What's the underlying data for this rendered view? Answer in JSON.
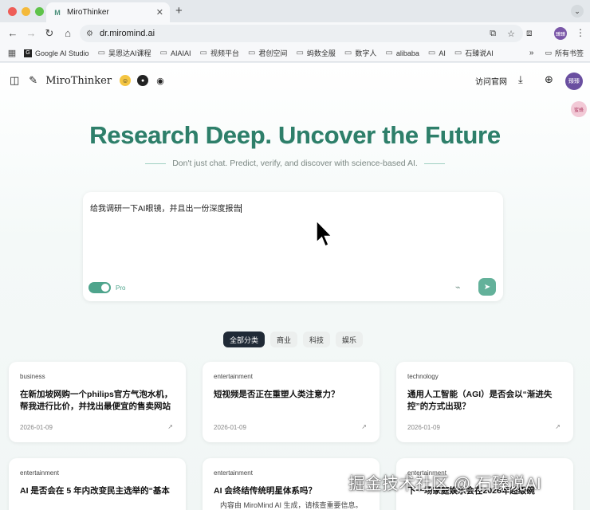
{
  "browser": {
    "tab_title": "MiroThinker",
    "tab_icon": "M",
    "url": "dr.miromind.ai",
    "profile_label": "臻臻",
    "bookmarks": [
      {
        "label": "Google AI Studio",
        "icon": "G"
      },
      {
        "label": "吴恩达AI课程",
        "icon": "folder"
      },
      {
        "label": "AIAIAI",
        "icon": "folder"
      },
      {
        "label": "视频平台",
        "icon": "folder"
      },
      {
        "label": "君创空间",
        "icon": "folder"
      },
      {
        "label": "蚂数全服",
        "icon": "folder"
      },
      {
        "label": "数字人",
        "icon": "folder"
      },
      {
        "label": "alibaba",
        "icon": "folder"
      },
      {
        "label": "AI",
        "icon": "folder"
      },
      {
        "label": "石臻说AI",
        "icon": "folder"
      }
    ],
    "bookmarks_more": "»",
    "all_bookmarks": "所有书签"
  },
  "app": {
    "brand": "MiroThinker",
    "visit_site": "访问官网",
    "user_label": "臻臻",
    "float_badge": "蜜蜂"
  },
  "hero": {
    "title": "Research Deep. Uncover the Future",
    "subtitle": "Don't just chat. Predict, verify, and discover with science-based AI."
  },
  "composer": {
    "text": "给我调研一下AI眼镜，并且出一份深度报告",
    "mode_label": "Pro",
    "pro_enabled": true
  },
  "categories": [
    {
      "label": "全部分类",
      "active": true
    },
    {
      "label": "商业",
      "active": false
    },
    {
      "label": "科技",
      "active": false
    },
    {
      "label": "娱乐",
      "active": false
    }
  ],
  "cards": [
    {
      "tag": "business",
      "title": "在新加坡网购一个philips官方气泡水机，帮我进行比价，并找出最便宜的售卖网站",
      "date": "2026-01-09"
    },
    {
      "tag": "entertainment",
      "title": "短视频是否正在重塑人类注意力？",
      "date": "2026-01-09"
    },
    {
      "tag": "technology",
      "title": "通用人工智能（AGI）是否会以“渐进失控”的方式出现？",
      "date": "2026-01-09"
    },
    {
      "tag": "entertainment",
      "title": "AI 是否会在 5 年内改变民主选举的“基本",
      "date": ""
    },
    {
      "tag": "entertainment",
      "title": "AI 会终结传统明星体系吗？",
      "date": ""
    },
    {
      "tag": "entertainment",
      "title": "下一场家庭娱乐会在2026年超级碗",
      "date": ""
    }
  ],
  "disclaimer": "内容由 MiroMind AI 生成，请核查重要信息。",
  "watermark": "掘金技术社区 @ 石臻说AI",
  "colors": {
    "accent": "#2e7f6a",
    "send_button": "#63b19a",
    "active_category": "#1f2a36"
  }
}
